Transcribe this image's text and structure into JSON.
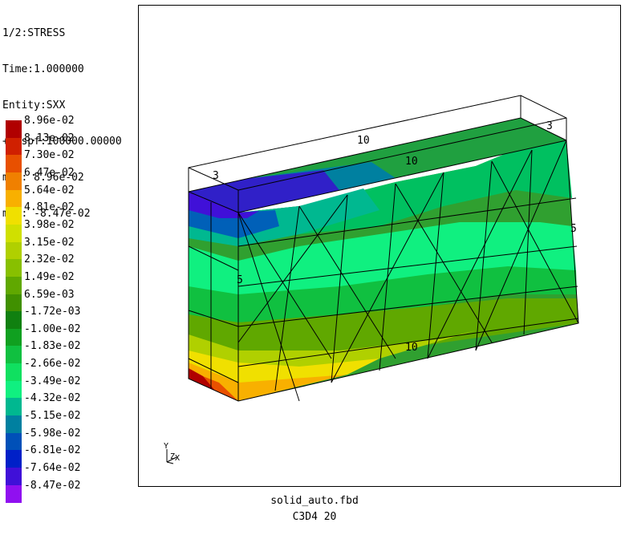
{
  "info": {
    "line1": "1/2:STRESS",
    "line2": "Time:1.000000",
    "line3": "Entity:SXX",
    "line4": "+Dispf:100000.00000",
    "line5": "max: 8.96e-02",
    "line6": "min: -8.47e-02"
  },
  "legend": [
    {
      "label": "8.96e-02",
      "color": "#b00000"
    },
    {
      "label": "8.13e-02",
      "color": "#d02000"
    },
    {
      "label": "7.30e-02",
      "color": "#e85000"
    },
    {
      "label": "6.47e-02",
      "color": "#f08000"
    },
    {
      "label": "5.64e-02",
      "color": "#f8b000"
    },
    {
      "label": "4.81e-02",
      "color": "#f0e000"
    },
    {
      "label": "3.98e-02",
      "color": "#d0e000"
    },
    {
      "label": "3.15e-02",
      "color": "#b0d000"
    },
    {
      "label": "2.32e-02",
      "color": "#88c000"
    },
    {
      "label": "1.49e-02",
      "color": "#60a800"
    },
    {
      "label": "6.59e-03",
      "color": "#409000"
    },
    {
      "label": "-1.72e-03",
      "color": "#108010"
    },
    {
      "label": "-1.00e-02",
      "color": "#10a020"
    },
    {
      "label": "-1.83e-02",
      "color": "#10c040"
    },
    {
      "label": "-2.66e-02",
      "color": "#10e060"
    },
    {
      "label": "-3.49e-02",
      "color": "#10f080"
    },
    {
      "label": "-4.32e-02",
      "color": "#00b890"
    },
    {
      "label": "-5.15e-02",
      "color": "#0080a0"
    },
    {
      "label": "-5.98e-02",
      "color": "#0050b8"
    },
    {
      "label": "-6.81e-02",
      "color": "#0020c8"
    },
    {
      "label": "-7.64e-02",
      "color": "#4010d8"
    },
    {
      "label": "-8.47e-02",
      "color": "#9010f0"
    }
  ],
  "model_labels": {
    "top_length": "10",
    "top_length_inner": "10",
    "depth_left": "3",
    "depth_right": "3",
    "height_left": "5",
    "height_right": "5",
    "bottom_length": "10"
  },
  "axes": {
    "y": "Y",
    "z": "Z",
    "x": "X"
  },
  "footer": {
    "file": "solid_auto.fbd",
    "mesh": "C3D4 20"
  }
}
